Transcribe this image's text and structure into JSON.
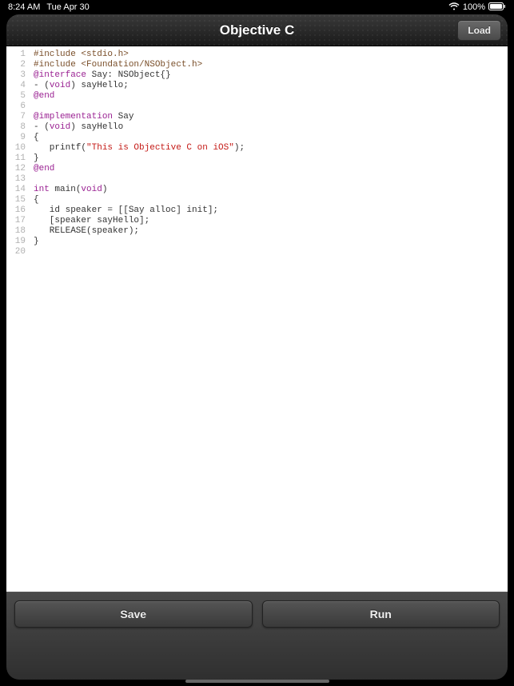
{
  "status": {
    "time": "8:24 AM",
    "date": "Tue Apr 30",
    "battery": "100%"
  },
  "header": {
    "title": "Objective C",
    "load_label": "Load"
  },
  "editor": {
    "line_count": 20,
    "lines": [
      {
        "segments": [
          {
            "t": "#include <stdio.h>",
            "c": "dir"
          }
        ]
      },
      {
        "segments": [
          {
            "t": "#include <Foundation/NSObject.h>",
            "c": "dir"
          }
        ]
      },
      {
        "segments": [
          {
            "t": "@interface",
            "c": "kw"
          },
          {
            "t": " Say: NSObject{}",
            "c": ""
          }
        ]
      },
      {
        "segments": [
          {
            "t": "- (",
            "c": ""
          },
          {
            "t": "void",
            "c": "kw"
          },
          {
            "t": ") sayHello;",
            "c": ""
          }
        ]
      },
      {
        "segments": [
          {
            "t": "@end",
            "c": "kw"
          }
        ]
      },
      {
        "segments": []
      },
      {
        "segments": [
          {
            "t": "@implementation",
            "c": "kw"
          },
          {
            "t": " Say",
            "c": ""
          }
        ]
      },
      {
        "segments": [
          {
            "t": "- (",
            "c": ""
          },
          {
            "t": "void",
            "c": "kw"
          },
          {
            "t": ") sayHello",
            "c": ""
          }
        ]
      },
      {
        "segments": [
          {
            "t": "{",
            "c": ""
          }
        ]
      },
      {
        "segments": [
          {
            "t": "   printf(",
            "c": ""
          },
          {
            "t": "\"This is Objective C on iOS\"",
            "c": "str"
          },
          {
            "t": ");",
            "c": ""
          }
        ]
      },
      {
        "segments": [
          {
            "t": "}",
            "c": ""
          }
        ]
      },
      {
        "segments": [
          {
            "t": "@end",
            "c": "kw"
          }
        ]
      },
      {
        "segments": []
      },
      {
        "segments": [
          {
            "t": "int",
            "c": "kw"
          },
          {
            "t": " main(",
            "c": ""
          },
          {
            "t": "void",
            "c": "kw"
          },
          {
            "t": ")",
            "c": ""
          }
        ]
      },
      {
        "segments": [
          {
            "t": "{",
            "c": ""
          }
        ]
      },
      {
        "segments": [
          {
            "t": "   id speaker = [[Say alloc] init];",
            "c": ""
          }
        ]
      },
      {
        "segments": [
          {
            "t": "   [speaker sayHello];",
            "c": ""
          }
        ]
      },
      {
        "segments": [
          {
            "t": "   RELEASE(speaker);",
            "c": ""
          }
        ]
      },
      {
        "segments": [
          {
            "t": "}",
            "c": ""
          }
        ]
      },
      {
        "segments": []
      }
    ]
  },
  "footer": {
    "save_label": "Save",
    "run_label": "Run"
  }
}
